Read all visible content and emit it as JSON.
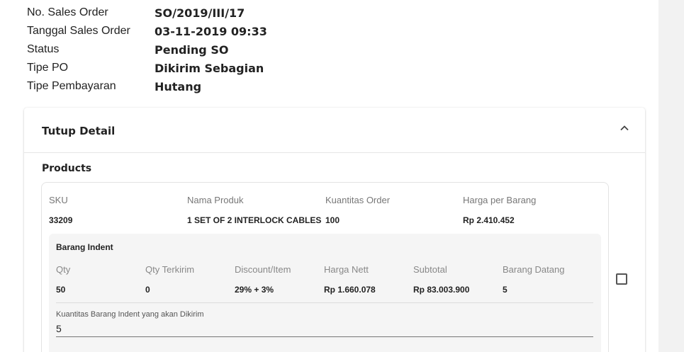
{
  "info": [
    {
      "label": "No. Sales Order",
      "value": "SO/2019/III/17"
    },
    {
      "label": "Tanggal Sales Order",
      "value": "03-11-2019 09:33"
    },
    {
      "label": "Status",
      "value": "Pending SO"
    },
    {
      "label": "Tipe PO",
      "value": "Dikirim Sebagian"
    },
    {
      "label": "Tipe Pembayaran",
      "value": "Hutang"
    }
  ],
  "detail": {
    "toggle_label": "Tutup Detail",
    "toggle_icon": "chevron-up-icon",
    "products_title": "Products"
  },
  "product": {
    "headers": {
      "sku": "SKU",
      "name": "Nama Produk",
      "qty": "Kuantitas Order",
      "price": "Harga per Barang"
    },
    "values": {
      "sku": "33209",
      "name": "1 SET OF 2 INTERLOCK CABLES",
      "qty": "100",
      "price": "Rp 2.410.452"
    }
  },
  "indent": {
    "title": "Barang Indent",
    "headers": {
      "qty": "Qty",
      "sent": "Qty Terkirim",
      "discount": "Discount/Item",
      "nett": "Harga Nett",
      "subtotal": "Subtotal",
      "arrived": "Barang Datang"
    },
    "values": {
      "qty": "50",
      "sent": "0",
      "discount": "29% + 3%",
      "nett": "Rp 1.660.078",
      "subtotal": "Rp 83.003.900",
      "arrived": "5"
    },
    "field_label": "Kuantitas Barang Indent yang akan Dikirim",
    "field_value": "5"
  }
}
